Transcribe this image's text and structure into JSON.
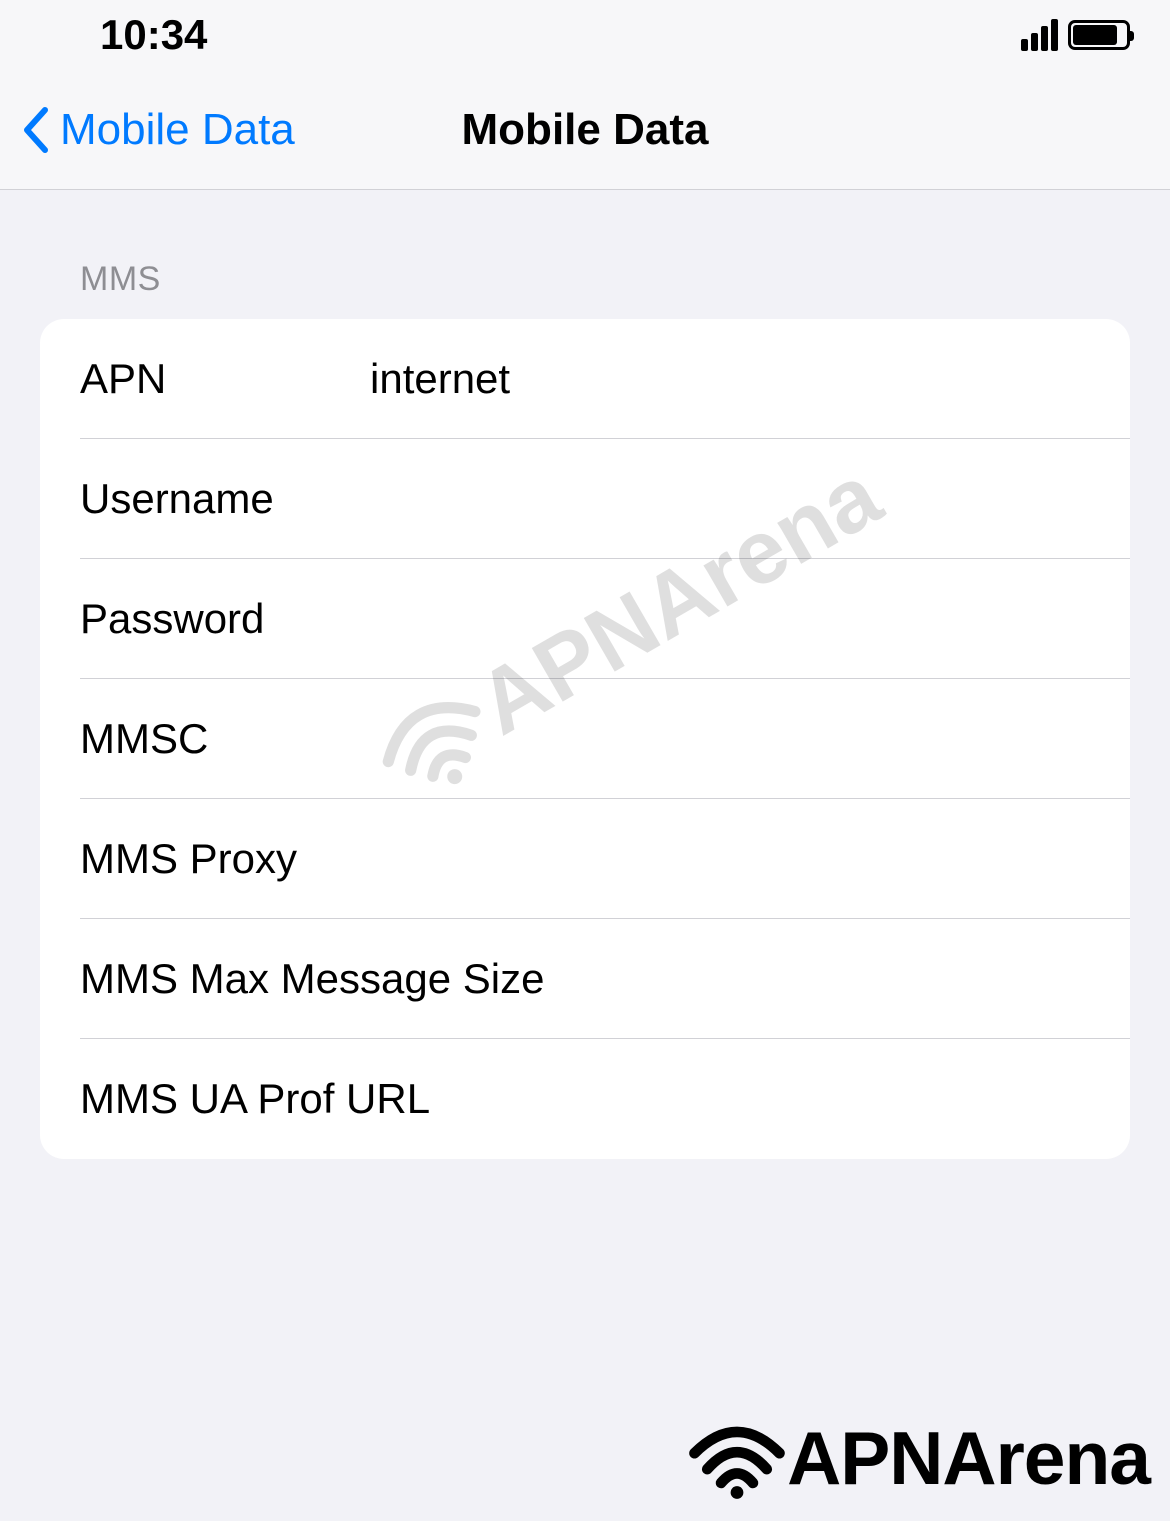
{
  "status": {
    "time": "10:34"
  },
  "nav": {
    "back_label": "Mobile Data",
    "title": "Mobile Data"
  },
  "section": {
    "header": "MMS"
  },
  "fields": {
    "apn": {
      "label": "APN",
      "value": "internet"
    },
    "username": {
      "label": "Username",
      "value": ""
    },
    "password": {
      "label": "Password",
      "value": ""
    },
    "mmsc": {
      "label": "MMSC",
      "value": ""
    },
    "mms_proxy": {
      "label": "MMS Proxy",
      "value": ""
    },
    "mms_max_size": {
      "label": "MMS Max Message Size",
      "value": ""
    },
    "mms_ua_prof": {
      "label": "MMS UA Prof URL",
      "value": ""
    }
  },
  "watermark": {
    "text": "APNArena"
  }
}
